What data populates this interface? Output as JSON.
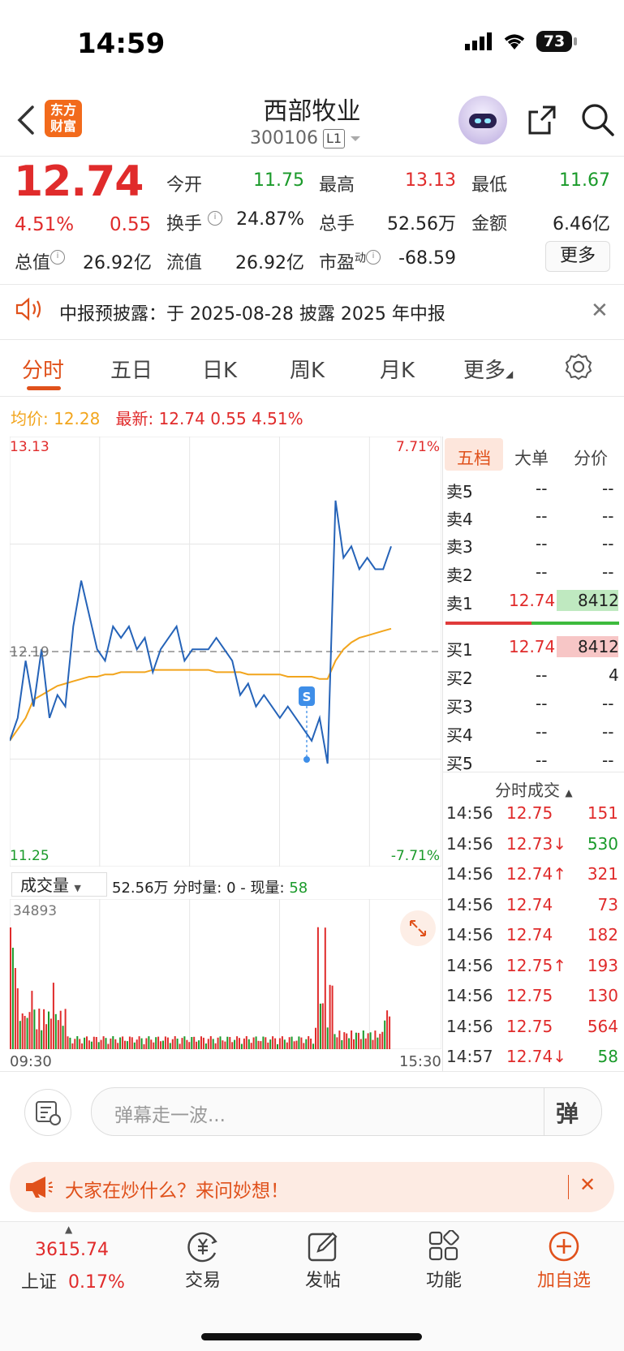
{
  "status": {
    "time": "14:59",
    "battery": "73"
  },
  "header": {
    "logo_line1": "东方",
    "logo_line2": "财富",
    "name": "西部牧业",
    "code": "300106",
    "level": "L1"
  },
  "quote": {
    "price": "12.74",
    "change_pct": "4.51%",
    "change": "0.55",
    "fields": [
      {
        "label": "今开",
        "value": "11.75",
        "color": "green"
      },
      {
        "label": "最高",
        "value": "13.13",
        "color": "red"
      },
      {
        "label": "最低",
        "value": "11.67",
        "color": "green"
      },
      {
        "label": "换手",
        "value": "24.87%",
        "color": "dark"
      },
      {
        "label": "总手",
        "value": "52.56万",
        "color": "dark"
      },
      {
        "label": "金额",
        "value": "6.46亿",
        "color": "dark"
      },
      {
        "label": "总值",
        "value": "26.92亿",
        "color": "dark"
      },
      {
        "label": "流值",
        "value": "26.92亿",
        "color": "dark"
      },
      {
        "label": "市盈",
        "value": "-68.59",
        "color": "dark"
      }
    ],
    "pe_sup": "动",
    "more": "更多"
  },
  "notice": {
    "text": "中报预披露：于 2025-08-28 披露 2025 年中报"
  },
  "tabs": [
    "分时",
    "五日",
    "日K",
    "周K",
    "月K",
    "更多"
  ],
  "chart_header": {
    "avg_label": "均价:",
    "avg_value": "12.28",
    "latest_label": "最新:",
    "latest_value": "12.74",
    "latest_change": "0.55",
    "latest_pct": "4.51%"
  },
  "chart_data": {
    "type": "line",
    "y_high": "13.13",
    "y_mid": "12.19",
    "y_low": "11.25",
    "pct_high": "7.71%",
    "pct_low": "-7.71%",
    "ylim": [
      11.25,
      13.13
    ],
    "prev_close": 12.19,
    "x_start": "09:30",
    "x_end": "15:30",
    "signal_label": "S",
    "price_series": [
      11.8,
      11.9,
      12.15,
      11.95,
      12.2,
      11.9,
      12.0,
      11.95,
      12.3,
      12.5,
      12.35,
      12.2,
      12.15,
      12.3,
      12.25,
      12.3,
      12.2,
      12.25,
      12.1,
      12.2,
      12.25,
      12.3,
      12.15,
      12.2,
      12.2,
      12.2,
      12.25,
      12.2,
      12.15,
      12.0,
      12.05,
      11.95,
      12.0,
      11.95,
      11.9,
      11.95,
      11.9,
      11.85,
      11.8,
      11.9,
      11.7,
      12.85,
      12.6,
      12.65,
      12.55,
      12.6,
      12.55,
      12.55,
      12.65
    ],
    "avg_series": [
      11.8,
      11.85,
      11.9,
      11.98,
      12.0,
      12.02,
      12.04,
      12.05,
      12.06,
      12.07,
      12.08,
      12.08,
      12.09,
      12.09,
      12.1,
      12.1,
      12.1,
      12.1,
      12.11,
      12.11,
      12.11,
      12.11,
      12.11,
      12.11,
      12.11,
      12.11,
      12.1,
      12.1,
      12.1,
      12.1,
      12.09,
      12.09,
      12.09,
      12.09,
      12.09,
      12.08,
      12.08,
      12.08,
      12.08,
      12.07,
      12.07,
      12.15,
      12.2,
      12.23,
      12.25,
      12.26,
      12.27,
      12.28,
      12.29
    ]
  },
  "volume": {
    "label": "成交量",
    "total": "52.56万",
    "fenshi_label": "分时量:",
    "fenshi_value": "0",
    "dash": "-",
    "now_label": "现量:",
    "now_value": "58",
    "max": "34893"
  },
  "orderbook": {
    "tabs": [
      "五档",
      "大单",
      "分价"
    ],
    "sells": [
      {
        "label": "卖5",
        "price": "--",
        "vol": "--"
      },
      {
        "label": "卖4",
        "price": "--",
        "vol": "--"
      },
      {
        "label": "卖3",
        "price": "--",
        "vol": "--"
      },
      {
        "label": "卖2",
        "price": "--",
        "vol": "--"
      },
      {
        "label": "卖1",
        "price": "12.74",
        "vol": "8412"
      }
    ],
    "buys": [
      {
        "label": "买1",
        "price": "12.74",
        "vol": "8412"
      },
      {
        "label": "买2",
        "price": "--",
        "vol": "4"
      },
      {
        "label": "买3",
        "price": "--",
        "vol": "--"
      },
      {
        "label": "买4",
        "price": "--",
        "vol": "--"
      },
      {
        "label": "买5",
        "price": "--",
        "vol": "--"
      }
    ],
    "ticks_title": "分时成交",
    "ticks": [
      {
        "time": "14:56",
        "price": "12.75",
        "arrow": "",
        "vol": "151",
        "vcolor": "red"
      },
      {
        "time": "14:56",
        "price": "12.73",
        "arrow": "↓",
        "vol": "530",
        "vcolor": "green"
      },
      {
        "time": "14:56",
        "price": "12.74",
        "arrow": "↑",
        "vol": "321",
        "vcolor": "red"
      },
      {
        "time": "14:56",
        "price": "12.74",
        "arrow": "",
        "vol": "73",
        "vcolor": "red"
      },
      {
        "time": "14:56",
        "price": "12.74",
        "arrow": "",
        "vol": "182",
        "vcolor": "red"
      },
      {
        "time": "14:56",
        "price": "12.75",
        "arrow": "↑",
        "vol": "193",
        "vcolor": "red"
      },
      {
        "time": "14:56",
        "price": "12.75",
        "arrow": "",
        "vol": "130",
        "vcolor": "red"
      },
      {
        "time": "14:56",
        "price": "12.75",
        "arrow": "",
        "vol": "564",
        "vcolor": "red"
      },
      {
        "time": "14:57",
        "price": "12.74",
        "arrow": "↓",
        "vol": "58",
        "vcolor": "green"
      }
    ]
  },
  "danmu": {
    "placeholder": "弹幕走一波...",
    "btn": "弹"
  },
  "banner": {
    "text": "大家在炒什么？来问妙想！"
  },
  "tabbar": {
    "index_value": "3615.74",
    "index_name": "上证",
    "index_pct": "0.17%",
    "items": [
      "交易",
      "发帖",
      "功能",
      "加自选"
    ]
  },
  "colors": {
    "red": "#e02b2b",
    "green": "#1a9a2a",
    "accent": "#e0511b",
    "avg": "#f2a51d",
    "price_line": "#2563b8"
  }
}
